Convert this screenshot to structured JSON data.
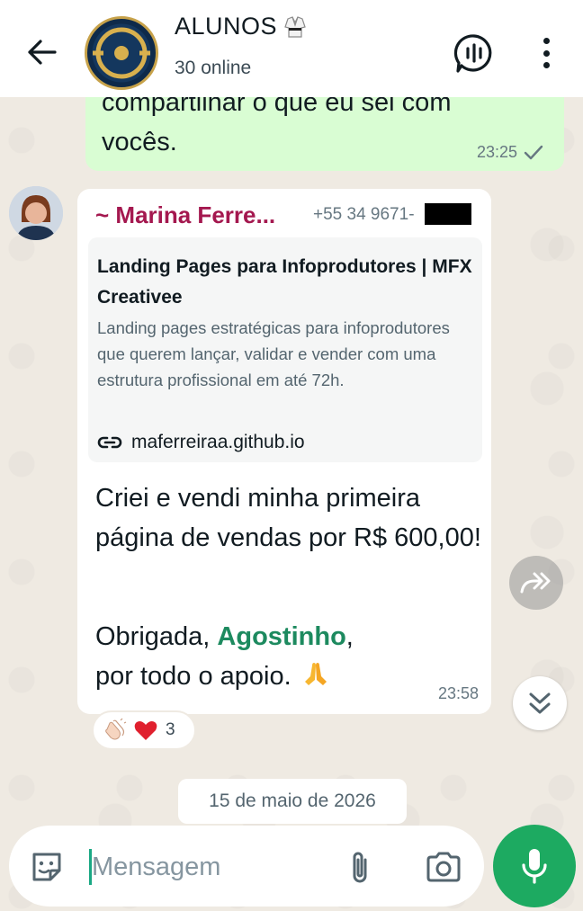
{
  "header": {
    "back_icon": "arrow-left-icon",
    "group_name": "ALUNOS",
    "group_emoji_icon": "martial-arts-uniform-icon",
    "status": "30 online",
    "call_icon": "group-call-icon",
    "menu_icon": "more-vertical-icon"
  },
  "outgoing_message": {
    "text_line1": "compartilhar o que eu sei com",
    "text_line2": "vocês.",
    "time": "23:25",
    "status_icon": "single-check-icon"
  },
  "incoming_message": {
    "sender_name": "~ Marina Ferre...",
    "sender_phone": "+55 34 9671-",
    "link_preview": {
      "title": "Landing Pages para Infoprodutores | MFX Creativee",
      "description": "Landing pages estratégicas para infoprodutores que querem lançar, validar e vender com uma estrutura profissional em até 72h.",
      "url": "maferreiraa.github.io",
      "url_icon": "link-icon"
    },
    "paragraph1": "Criei e vendi minha primeira página de vendas por R$ 600,00!",
    "paragraph2_prefix": "Obrigada, ",
    "mention": "Agostinho",
    "paragraph2_comma": ",",
    "paragraph2_suffix": "por todo o apoio.",
    "paragraph2_emoji_icon": "folded-hands-icon",
    "time": "23:58"
  },
  "reactions": {
    "emojis": [
      "clapping-hands-icon",
      "red-heart-icon"
    ],
    "count": "3"
  },
  "date_separator": "15 de maio de 2026",
  "composer": {
    "placeholder": "Mensagem",
    "sticker_icon": "sticker-icon",
    "attach_icon": "paperclip-icon",
    "camera_icon": "camera-icon",
    "mic_icon": "microphone-icon"
  },
  "colors": {
    "accent_green": "#1daa61",
    "sender_name": "#a4184f",
    "mention": "#1d8a5f",
    "outgoing_bubble": "#d9fdd3",
    "wallpaper": "#efeae2"
  }
}
